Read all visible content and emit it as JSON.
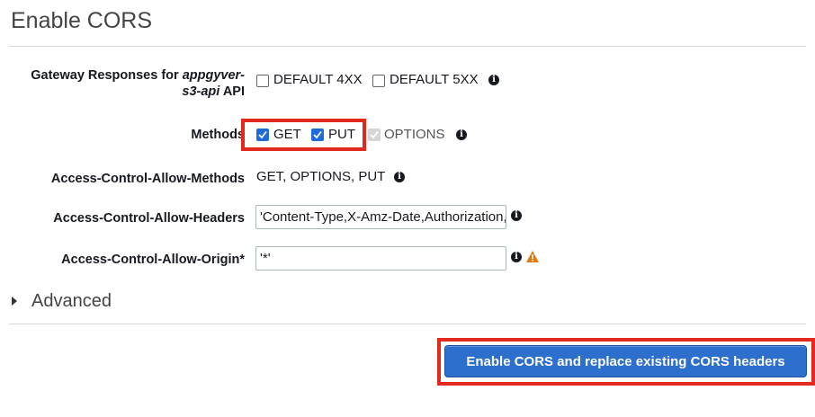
{
  "page": {
    "title": "Enable CORS"
  },
  "gateway_responses": {
    "label_prefix": "Gateway Responses for ",
    "label_api_line1": "appgyver-",
    "label_api_line2": "s3-api",
    "label_suffix": " API",
    "options": [
      {
        "label": "DEFAULT 4XX",
        "checked": false
      },
      {
        "label": "DEFAULT 5XX",
        "checked": false
      }
    ]
  },
  "methods": {
    "label": "Methods",
    "options": [
      {
        "label": "GET",
        "checked": true
      },
      {
        "label": "PUT",
        "checked": true
      },
      {
        "label": "OPTIONS",
        "checked": true,
        "disabled": true
      }
    ]
  },
  "allow_methods": {
    "label": "Access-Control-Allow-Methods",
    "value": "GET, OPTIONS, PUT"
  },
  "allow_headers": {
    "label": "Access-Control-Allow-Headers",
    "value": "'Content-Type,X-Amz-Date,Authorization,X-Api-Key,X-Amz-Security-Token'"
  },
  "allow_origin": {
    "label": "Access-Control-Allow-Origin*",
    "value": "'*'"
  },
  "advanced": {
    "label": "Advanced"
  },
  "submit": {
    "label": "Enable CORS and replace existing CORS headers"
  },
  "colors": {
    "accent": "#1f6cd9",
    "button": "#2d6fcd",
    "highlight_box": "#e3281d",
    "warning": "#e07b10"
  }
}
